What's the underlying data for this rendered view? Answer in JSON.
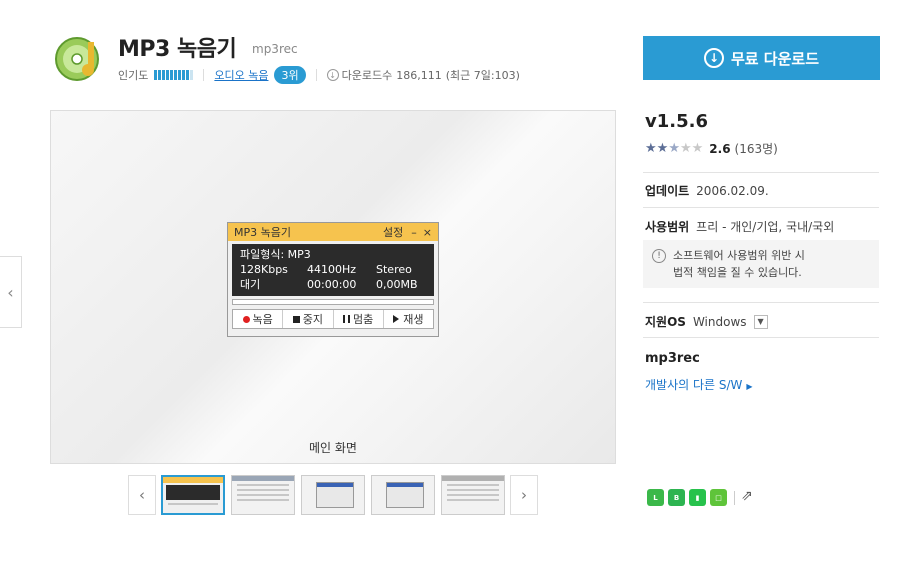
{
  "app": {
    "name": "MP3 녹음기",
    "sub": "mp3rec",
    "popularity_label": "인기도",
    "popularity_level": 0.85,
    "category": "오디오 녹음",
    "rank": "3위",
    "downloads_label": "다운로드수",
    "downloads": "186,111",
    "recent": "(최근 7일:103)"
  },
  "download_button": {
    "label": "무료 다운로드"
  },
  "viewer": {
    "caption": "메인 화면",
    "player": {
      "title": "MP3 녹음기",
      "settings": "설정",
      "minimize": "–",
      "close": "×",
      "format_line": "파일형식: MP3",
      "bitrate": "128Kbps",
      "samplerate": "44100Hz",
      "channels": "Stereo",
      "status": "대기",
      "time": "00:00:00",
      "size": "0,00MB",
      "btn_record": "녹음",
      "btn_stop": "중지",
      "btn_pause": "멈춤",
      "btn_play": "재생"
    },
    "prev_arrow": "‹",
    "thumbs_prev": "‹",
    "thumbs_next": "›"
  },
  "info": {
    "version": "v1.5.6",
    "rating_score": "2.6",
    "rating_count": "(163명)",
    "stars_filled": "★★",
    "stars_half": "★",
    "stars_empty": "★★",
    "update_label": "업데이트",
    "update_value": "2006.02.09.",
    "license_label": "사용범위",
    "license_value": "프리 - 개인/기업, 국내/국외",
    "notice_line1": "소프트웨어 사용범위 위반 시",
    "notice_line2": "법적 책임을 질 수 있습니다.",
    "os_label": "지원OS",
    "os_value": "Windows",
    "developer": "mp3rec",
    "developer_link": "개발사의 다른 S/W"
  }
}
